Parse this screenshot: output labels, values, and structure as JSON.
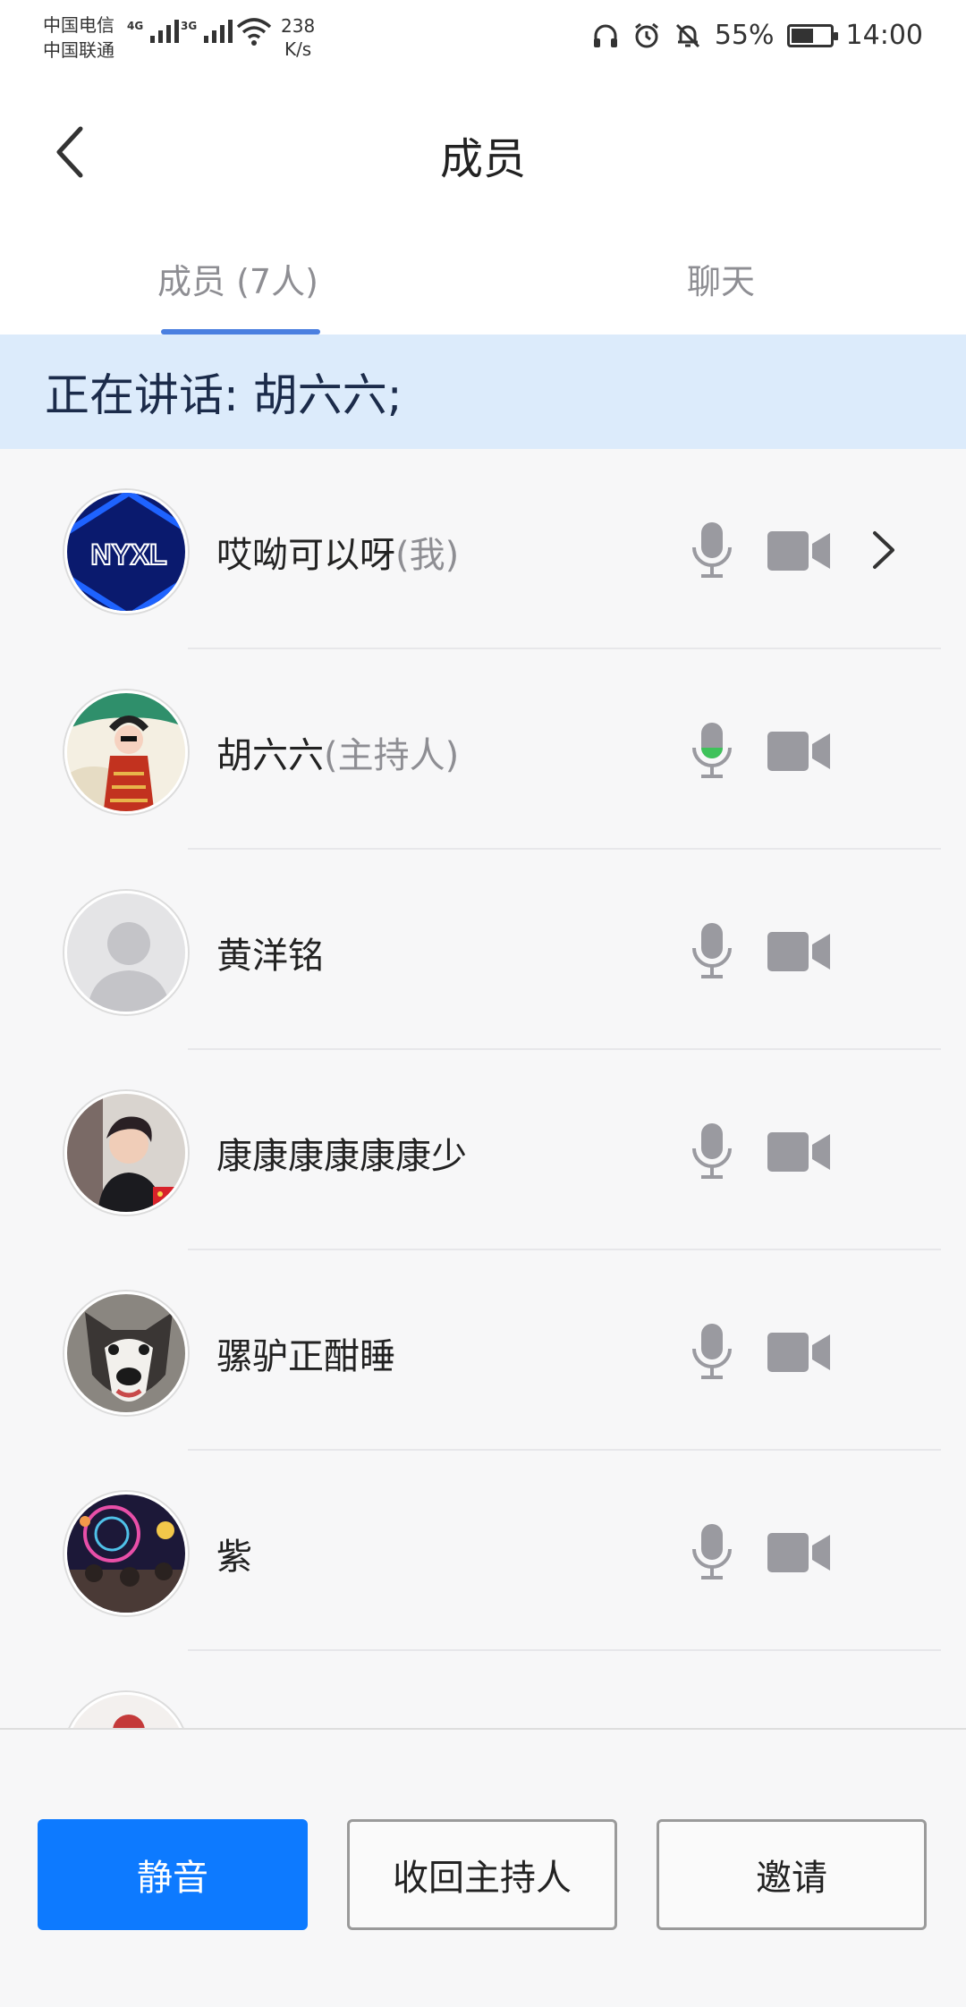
{
  "status_bar": {
    "carrier1": "中国电信",
    "carrier2": "中国联通",
    "sig1_tag": "4G",
    "sig2_tag": "3G",
    "net_speed_value": "238",
    "net_speed_unit": "K/s",
    "battery": "55%",
    "battery_level": 0.55,
    "time": "14:00"
  },
  "nav": {
    "title": "成员"
  },
  "tabs": [
    {
      "label": "成员 (7人)",
      "active": true
    },
    {
      "label": "聊天",
      "active": false
    }
  ],
  "speaking_banner": "正在讲话: 胡六六;",
  "members": [
    {
      "name": "哎呦可以呀",
      "role": "(我)",
      "avatar": "nyxl-logo-avatar",
      "mic_active": false,
      "has_chevron": true
    },
    {
      "name": "胡六六",
      "role": "(主持人)",
      "avatar": "opera-figure-avatar",
      "mic_active": true,
      "has_chevron": false
    },
    {
      "name": "黄洋铭",
      "role": "",
      "avatar": "default-person-avatar",
      "mic_active": false,
      "has_chevron": false
    },
    {
      "name": "康康康康康康少",
      "role": "",
      "avatar": "young-man-avatar",
      "mic_active": false,
      "has_chevron": false
    },
    {
      "name": "骡驴正酣睡",
      "role": "",
      "avatar": "husky-dog-avatar",
      "mic_active": false,
      "has_chevron": false
    },
    {
      "name": "紫",
      "role": "",
      "avatar": "night-fair-avatar",
      "mic_active": false,
      "has_chevron": false
    }
  ],
  "buttons": {
    "mute": "静音",
    "reclaim_host": "收回主持人",
    "invite": "邀请"
  },
  "colors": {
    "accent": "#0d7aff",
    "tab_underline": "#4a7fe0",
    "banner_bg": "#dcebfb",
    "mic_active": "#3ec25a",
    "icon_gray": "#9a9aa0"
  }
}
